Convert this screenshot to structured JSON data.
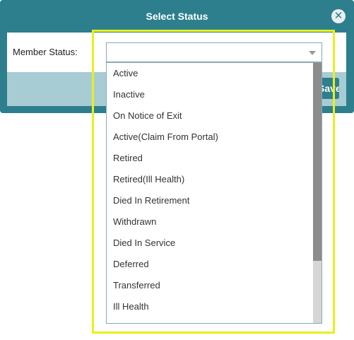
{
  "dialog": {
    "title": "Select Status",
    "close_symbol": "✕",
    "save_label": "Save"
  },
  "form": {
    "member_status_label": "Member Status:",
    "selected_value": ""
  },
  "dropdown": {
    "options": [
      "Active",
      "Inactive",
      "On Notice of Exit",
      "Active(Claim From Portal)",
      "Retired",
      "Retired(Ill Health)",
      "Died In Retirement",
      "Withdrawn",
      "Died In Service",
      "Deferred",
      "Transferred",
      "Ill Health"
    ]
  },
  "colors": {
    "header": "#2d7f8e",
    "highlight": "#e8f01c"
  },
  "icons": {
    "close": "close-icon",
    "dropdown_arrow": "chevron-down-icon"
  }
}
